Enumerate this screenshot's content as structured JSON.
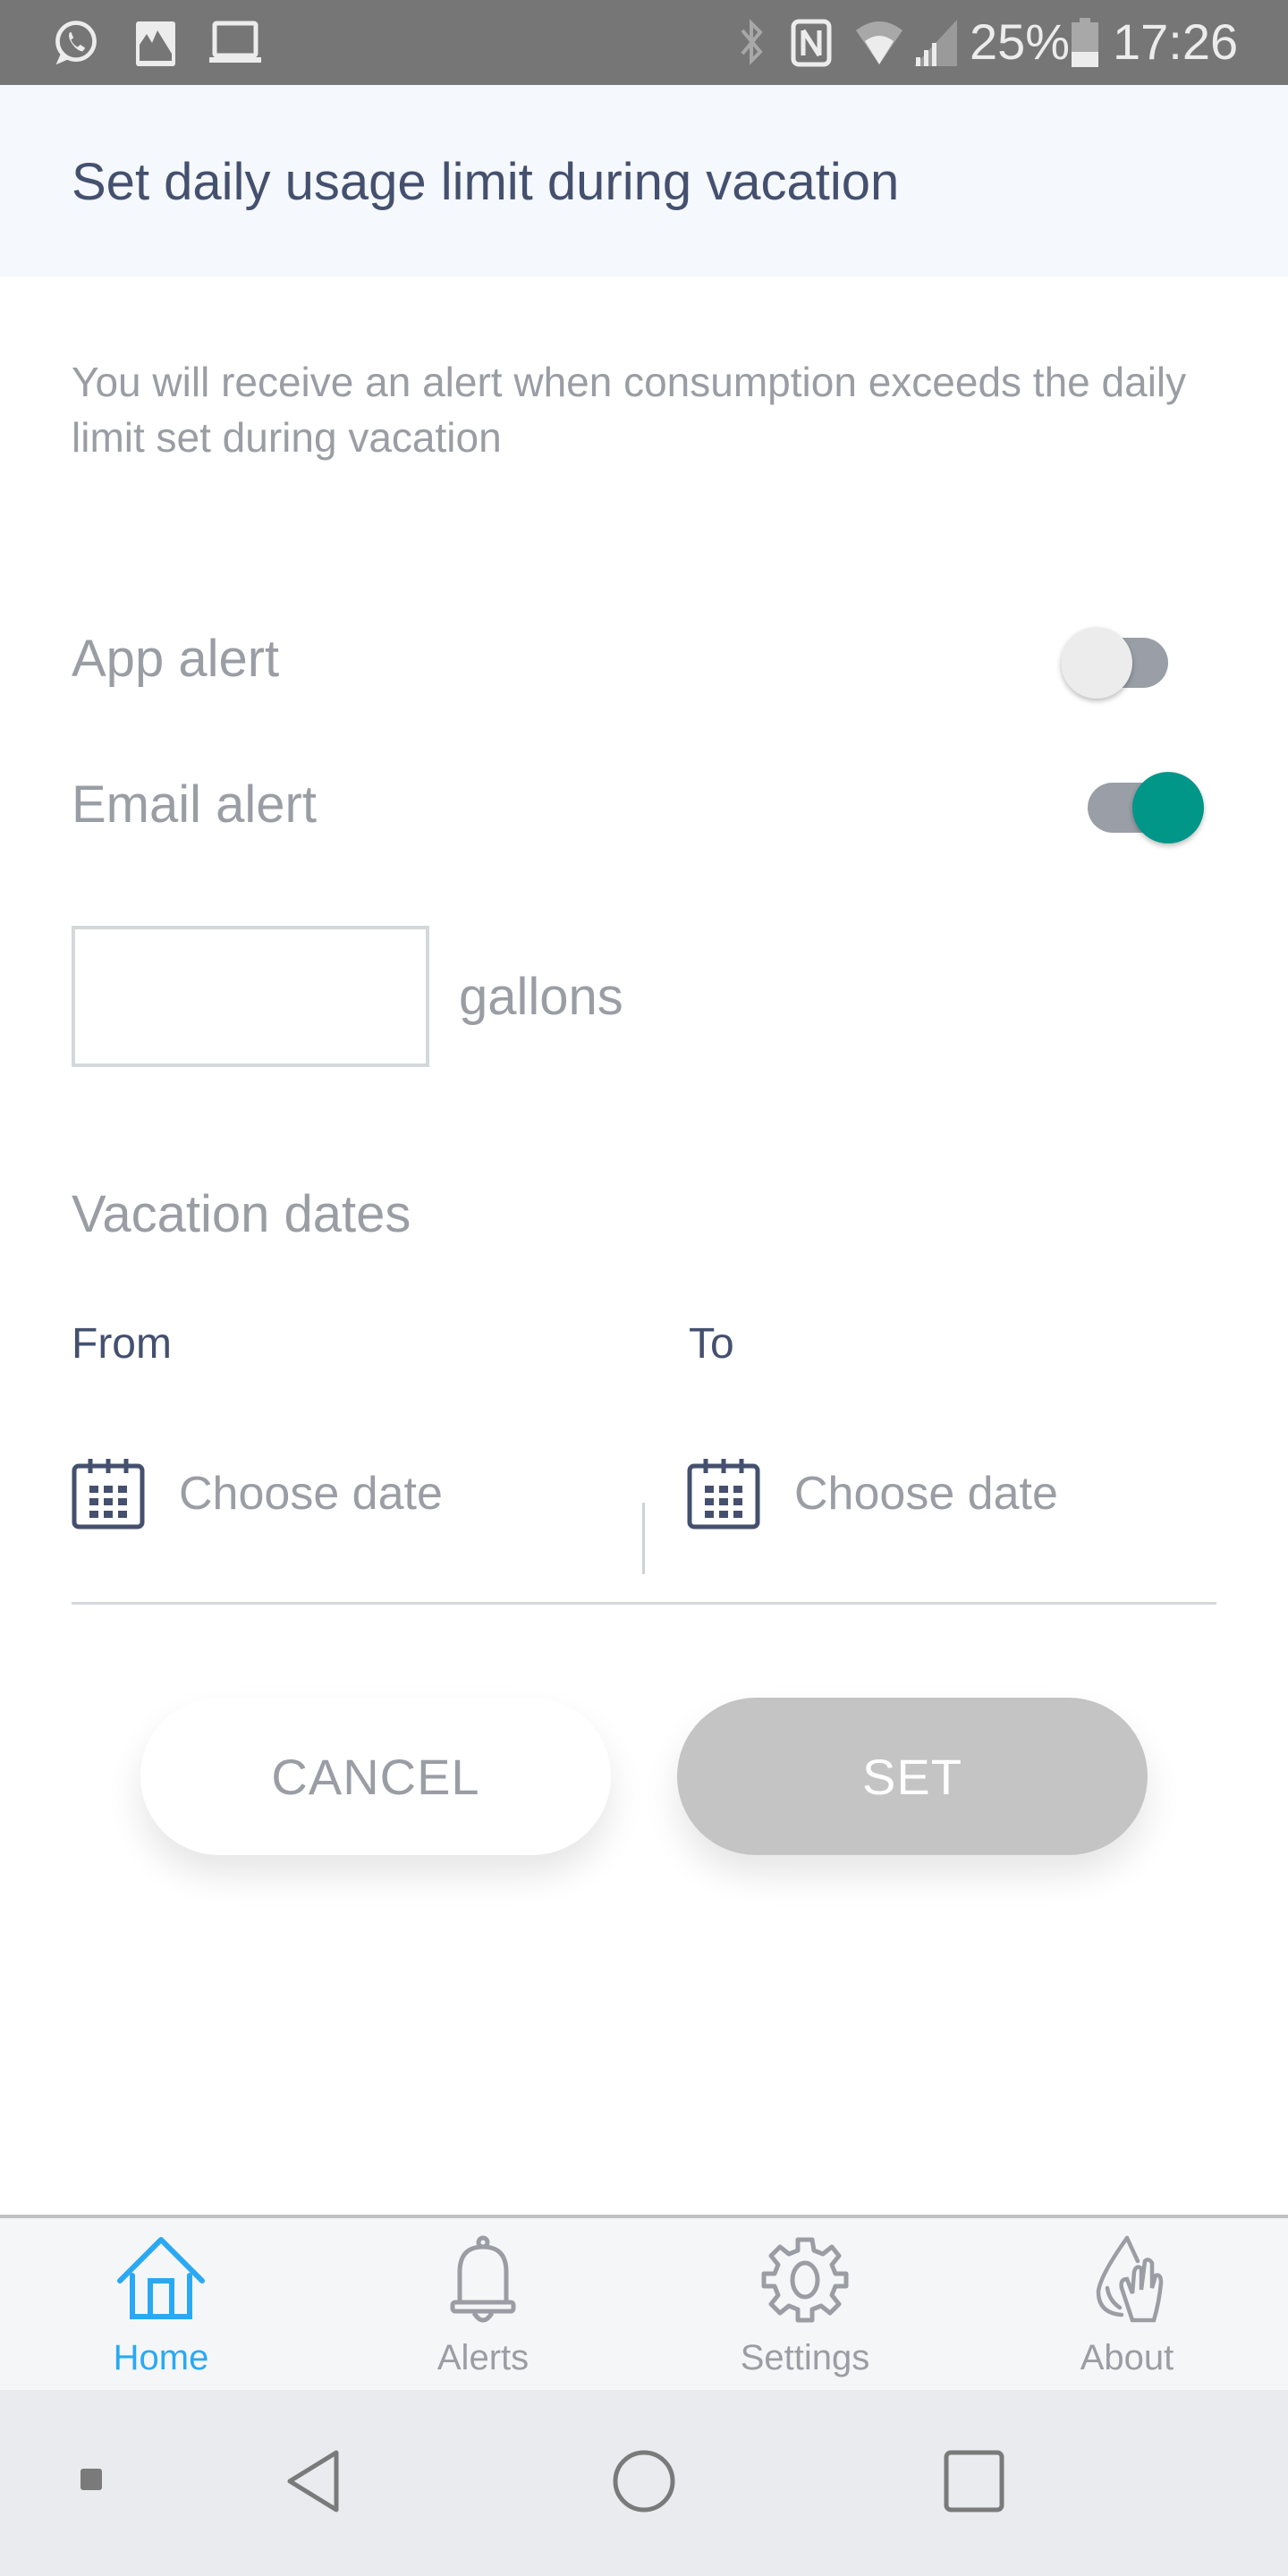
{
  "status_bar": {
    "left_icons": [
      "whatsapp-icon",
      "gallery-icon",
      "laptop-icon"
    ],
    "right_icons": [
      "bluetooth-icon",
      "nfc-icon",
      "wifi-icon",
      "signal-icon",
      "battery-icon"
    ],
    "battery": "25%",
    "time": "17:26"
  },
  "header": {
    "title": "Set daily usage limit during vacation"
  },
  "description": "You will receive an alert when consumption exceeds the daily limit set during vacation",
  "alerts": {
    "app_alert": {
      "label": "App alert",
      "enabled": false
    },
    "email_alert": {
      "label": "Email alert",
      "enabled": true
    }
  },
  "limit": {
    "value": "",
    "placeholder": "",
    "unit": "gallons"
  },
  "vacation": {
    "title": "Vacation dates",
    "from_label": "From",
    "to_label": "To",
    "from_placeholder": "Choose date",
    "to_placeholder": "Choose date"
  },
  "buttons": {
    "cancel": "CANCEL",
    "set": "SET"
  },
  "bottom_nav": {
    "items": [
      {
        "label": "Home",
        "icon": "home-icon",
        "active": true
      },
      {
        "label": "Alerts",
        "icon": "bell-icon",
        "active": false
      },
      {
        "label": "Settings",
        "icon": "gear-icon",
        "active": false
      },
      {
        "label": "About",
        "icon": "water-hand-icon",
        "active": false
      }
    ]
  },
  "system_nav": [
    "dot-icon",
    "back-icon",
    "home-circle-icon",
    "recents-icon"
  ],
  "colors": {
    "accent": "#2aa9f3",
    "toggle_on": "#009688",
    "toggle_off_knob": "#ececec",
    "text_primary": "#44506e",
    "text_secondary": "#9a9da4",
    "set_disabled": "#c4c4c4"
  }
}
